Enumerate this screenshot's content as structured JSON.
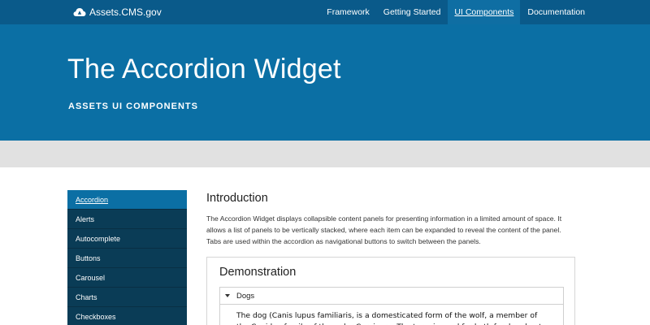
{
  "header": {
    "brand": "Assets.CMS.gov",
    "brand_icon": "cloud-icon",
    "nav": [
      {
        "label": "Framework"
      },
      {
        "label": "Getting Started"
      },
      {
        "label": "UI Components",
        "active": true
      },
      {
        "label": "Documentation"
      }
    ]
  },
  "hero": {
    "title": "The Accordion Widget",
    "subtitle": "ASSETS UI COMPONENTS"
  },
  "sidebar": {
    "items": [
      {
        "label": "Accordion",
        "active": true
      },
      {
        "label": "Alerts"
      },
      {
        "label": "Autocomplete"
      },
      {
        "label": "Buttons"
      },
      {
        "label": "Carousel"
      },
      {
        "label": "Charts"
      },
      {
        "label": "Checkboxes"
      }
    ]
  },
  "main": {
    "heading": "Introduction",
    "intro": "The Accordion Widget displays collapsible content panels for presenting information in a limited amount of space. It allows a list of panels to be vertically stacked, where each item can be expanded to reveal the content of the panel. Tabs are used within the accordion as navigational buttons to switch between the panels.",
    "demo": {
      "heading": "Demonstration",
      "panel_title": "Dogs",
      "panel_body": "The dog (Canis lupus familiaris, is a domesticated form of the wolf, a member of the Canidae family of the order Carnivora. The term is used for both feral and pet"
    }
  },
  "colors": {
    "topbar": "#0a5a8a",
    "hero": "#0b6fa4",
    "sidebar": "#0a3c56",
    "sidebar_active": "#0b6fa4"
  }
}
